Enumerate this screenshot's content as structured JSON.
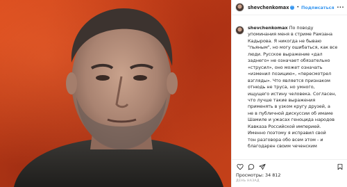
{
  "header": {
    "username": "shevchenkomax",
    "separator": "•",
    "follow_label": "Подписаться",
    "more_icon": "more-horizontal-icon"
  },
  "caption": {
    "username": "shevchenkomax",
    "lines": [
      "По поводу",
      "упоминания меня в стриме Рамзана",
      "Кадырова. Я никогда не бываю",
      "\"пьяным\", но могу ошибаться, как все",
      "люди. Русское выражение «дал",
      "заднего» не означает обязательно",
      "«струсил», оно может означать",
      "«изменил позицию», «пересмотрел",
      "взгляды». Что является признаком",
      "отнюдь не труса, но умного,",
      "ищущего истину человека. Согласен,",
      "что лучше такие выражения",
      "применять в узком кругу друзей, а",
      "не в публичной дискуссии об имаме",
      "Шамиле и ужасах геноцида народов",
      "Кавказа Российской империей.",
      "Именно поэтому я исправил свой",
      "тон разговора обо всем этом - и",
      "благодарен своим чеченским"
    ]
  },
  "footer": {
    "views_label": "Просмотры:",
    "views_count": "34 812",
    "timestamp": "ДЕНЬ НАЗАД",
    "icons": [
      "heart-icon",
      "comment-icon",
      "share-icon",
      "bookmark-icon"
    ]
  },
  "colors": {
    "accent": "#3897f0",
    "background_wall": "#c9421a",
    "text": "#262626"
  }
}
